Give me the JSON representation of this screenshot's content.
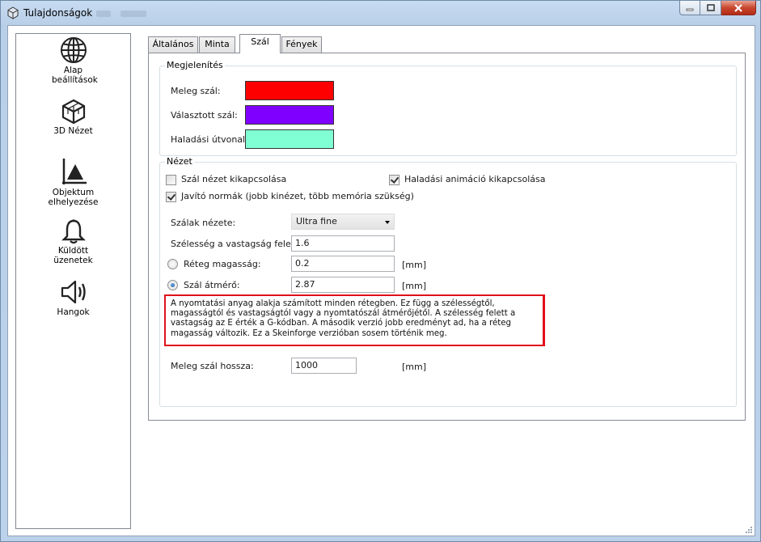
{
  "window": {
    "title": "Tulajdonságok"
  },
  "sidebar": {
    "items": [
      {
        "label": "Alap beállítások",
        "icon": "globe-icon"
      },
      {
        "label": "3D Nézet",
        "icon": "cube-icon"
      },
      {
        "label": "Objektum elhelyezése",
        "icon": "object-placement-icon"
      },
      {
        "label": "Küldött üzenetek",
        "icon": "bell-icon"
      },
      {
        "label": "Hangok",
        "icon": "speaker-icon"
      }
    ]
  },
  "tabs": [
    {
      "label": "Általános",
      "active": false
    },
    {
      "label": "Minta",
      "active": false
    },
    {
      "label": "Szál",
      "active": true
    },
    {
      "label": "Fények",
      "active": false
    }
  ],
  "appearance": {
    "legend": "Megjelenítés",
    "rows": [
      {
        "label": "Meleg szál:",
        "color": "#ff0000"
      },
      {
        "label": "Választott szál:",
        "color": "#8000ff"
      },
      {
        "label": "Haladási útvonal:",
        "color": "#80ffd4"
      }
    ]
  },
  "view": {
    "legend": "Nézet",
    "checkboxes": {
      "disable_filament_view": {
        "label": "Szál nézet kikapcsolása",
        "checked": false
      },
      "disable_progress_animation": {
        "label": "Haladási animáció kikapcsolása",
        "checked": true
      },
      "fix_normals": {
        "label": "Javító normák (jobb kinézet, több memória szükség)",
        "checked": true
      }
    },
    "filament_view": {
      "label": "Szálak nézete:",
      "value": "Ultra fine"
    },
    "width_over_thickness": {
      "label": "Szélesség a vastagság felett:",
      "value": "1.6"
    },
    "layer_height": {
      "label": "Réteg magasság:",
      "value": "0.2",
      "unit": "[mm]",
      "selected": false
    },
    "filament_diameter": {
      "label": "Szál átmérő:",
      "value": "2.87",
      "unit": "[mm]",
      "selected": true
    },
    "tooltip": "A nyomtatási anyag alakja számított minden rétegben. Ez függ a szélességtől, magasságtól és vastagságtól vagy a nyomtatószál átmérőjétől. A szélesség felett a vastagság az E érték a G-kódban. A második verzió jobb eredményt ad, ha a réteg magasság változik. Ez a Skeinforge verzióban sosem történik meg.",
    "hot_filament_length": {
      "label": "Meleg szál hossza:",
      "value": "1000",
      "unit": "[mm]"
    }
  },
  "colors": {
    "highlight_border": "#e0101a",
    "window_chrome": "#c7dbf1"
  }
}
